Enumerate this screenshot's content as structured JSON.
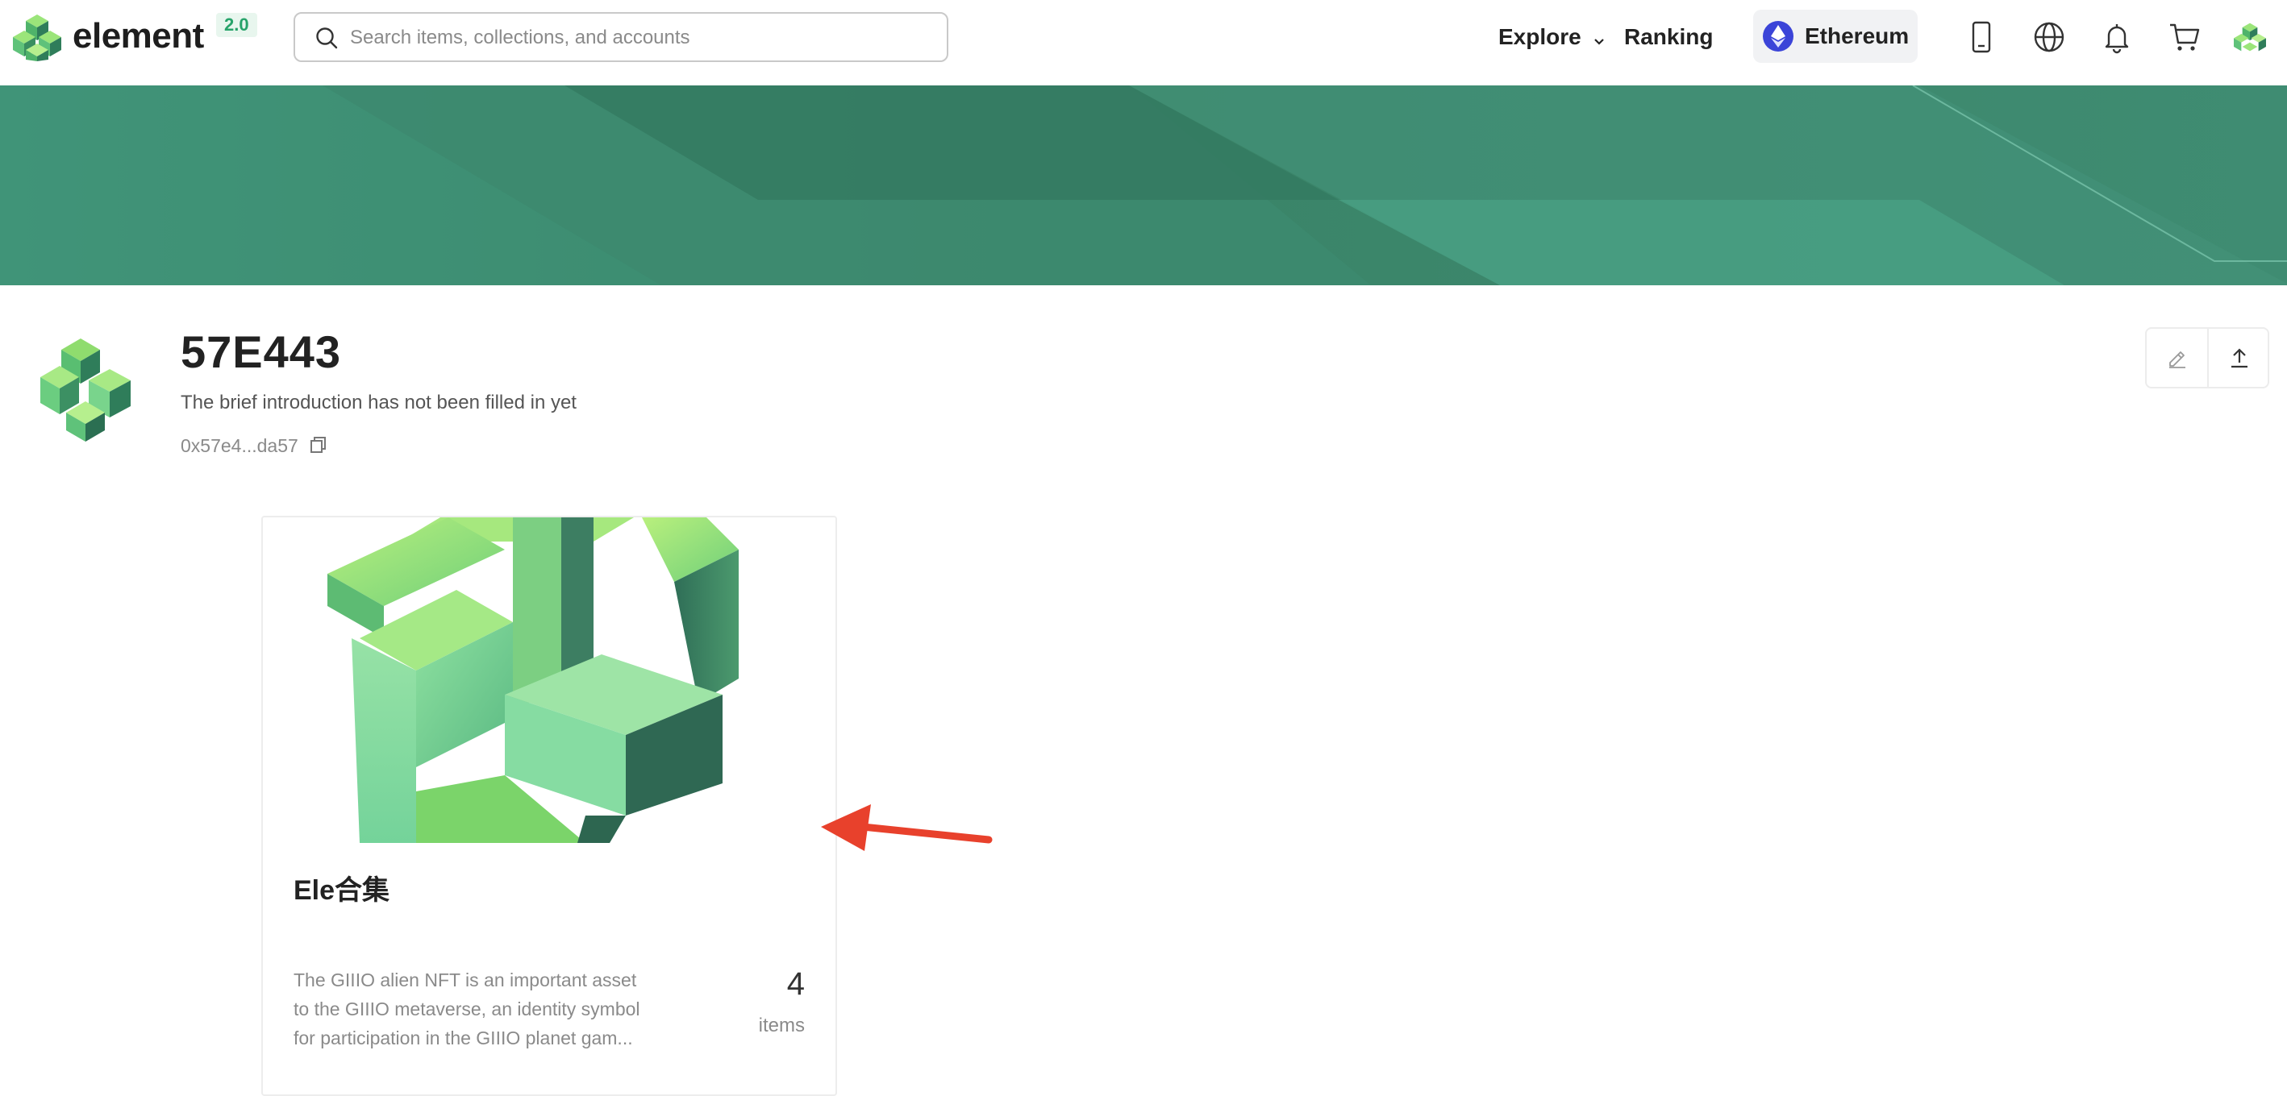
{
  "header": {
    "brand": "element",
    "version": "2.0",
    "search_placeholder": "Search items, collections, and accounts",
    "nav": {
      "explore": "Explore",
      "ranking": "Ranking"
    },
    "chain": "Ethereum",
    "icons": [
      "mobile-icon",
      "globe-icon",
      "bell-icon",
      "cart-icon",
      "user-avatar"
    ]
  },
  "profile": {
    "name": "57E443",
    "bio": "The brief introduction has not been filled in yet",
    "address": "0x57e4...da57"
  },
  "collection": {
    "title": "Ele合集",
    "description": "The GIIIO alien NFT is an important asset to the GIIIO metaverse, an identity symbol for participation in the GIIIO planet gam...",
    "count": "4",
    "count_label": "items"
  },
  "colors": {
    "brand_green": "#3e8a70",
    "accent_green": "#27a36a",
    "eth_blue": "#3b44d8",
    "annotation_red": "#e8412c"
  }
}
